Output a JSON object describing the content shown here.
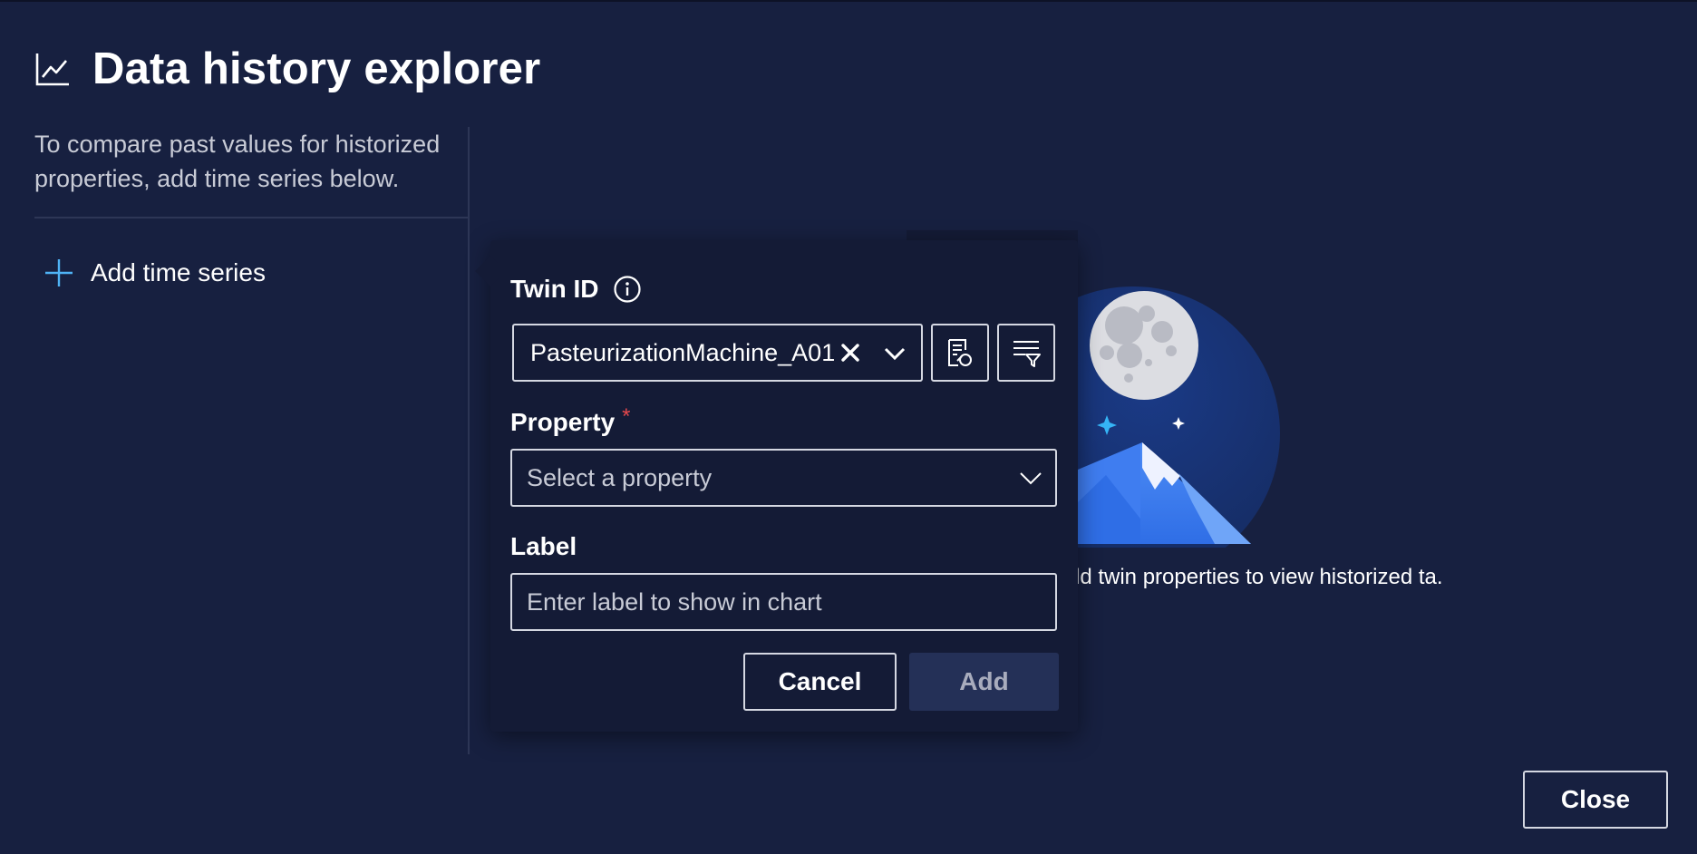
{
  "header": {
    "title": "Data history explorer",
    "icon": "line-chart-icon"
  },
  "left_panel": {
    "description": "To compare past values for historized properties, add time series below.",
    "add_series_label": "Add time series",
    "add_series_icon": "plus-icon"
  },
  "empty_state": {
    "text": "ld twin properties to view historized ta."
  },
  "dialog": {
    "twin_id": {
      "label": "Twin ID",
      "info_icon": "info-icon",
      "value": "PasteurizationMachine_A01",
      "clear_icon": "close-icon",
      "dropdown_icon": "chevron-down-icon",
      "browse_icon": "twin-browse-icon",
      "filter_icon": "filter-icon"
    },
    "property": {
      "label": "Property",
      "required_marker": "*",
      "placeholder": "Select a property"
    },
    "label_field": {
      "label": "Label",
      "placeholder": "Enter label to show in chart"
    },
    "buttons": {
      "cancel": "Cancel",
      "add": "Add"
    }
  },
  "footer": {
    "close_label": "Close"
  },
  "colors": {
    "background": "#172040",
    "dialog_background": "#141b36",
    "accent": "#4fb3f6",
    "required": "#e5484d",
    "disabled_button": "#243057"
  }
}
